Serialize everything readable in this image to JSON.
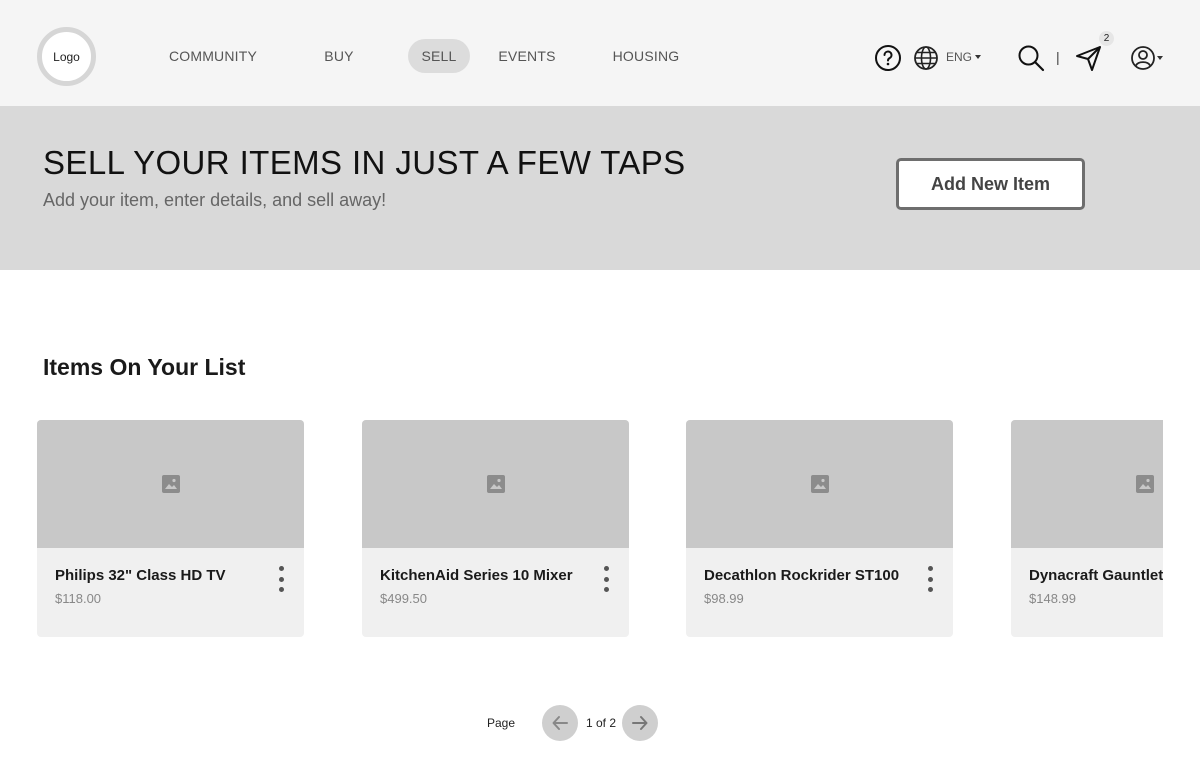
{
  "header": {
    "logo_text": "Logo",
    "nav": [
      {
        "label": "COMMUNITY",
        "active": false
      },
      {
        "label": "BUY",
        "active": false
      },
      {
        "label": "SELL",
        "active": true
      },
      {
        "label": "EVENTS",
        "active": false
      },
      {
        "label": "HOUSING",
        "active": false
      }
    ],
    "language": "ENG",
    "divider": "|",
    "messages_badge": "2",
    "icons": [
      "help-icon",
      "globe-icon",
      "search-icon",
      "send-icon",
      "user-icon"
    ]
  },
  "hero": {
    "title": "SELL YOUR ITEMS IN JUST A FEW TAPS",
    "subtitle": "Add your item, enter details, and sell away!",
    "button_label": "Add New Item"
  },
  "list": {
    "title": "Items On Your List",
    "items": [
      {
        "name": "Philips 32\" Class HD TV",
        "price": "$118.00"
      },
      {
        "name": "KitchenAid Series 10 Mixer",
        "price": "$499.50"
      },
      {
        "name": "Decathlon Rockrider ST100",
        "price": "$98.99"
      },
      {
        "name": "Dynacraft Gauntlet",
        "price": "$148.99"
      }
    ]
  },
  "pagination": {
    "label": "Page",
    "count": "1 of 2"
  },
  "colors": {
    "header_bg": "#f5f5f5",
    "hero_bg": "#d9d9d9",
    "card_bg": "#f0f0f0",
    "image_placeholder": "#c8c8c8",
    "active_nav": "#dcdcdc"
  }
}
